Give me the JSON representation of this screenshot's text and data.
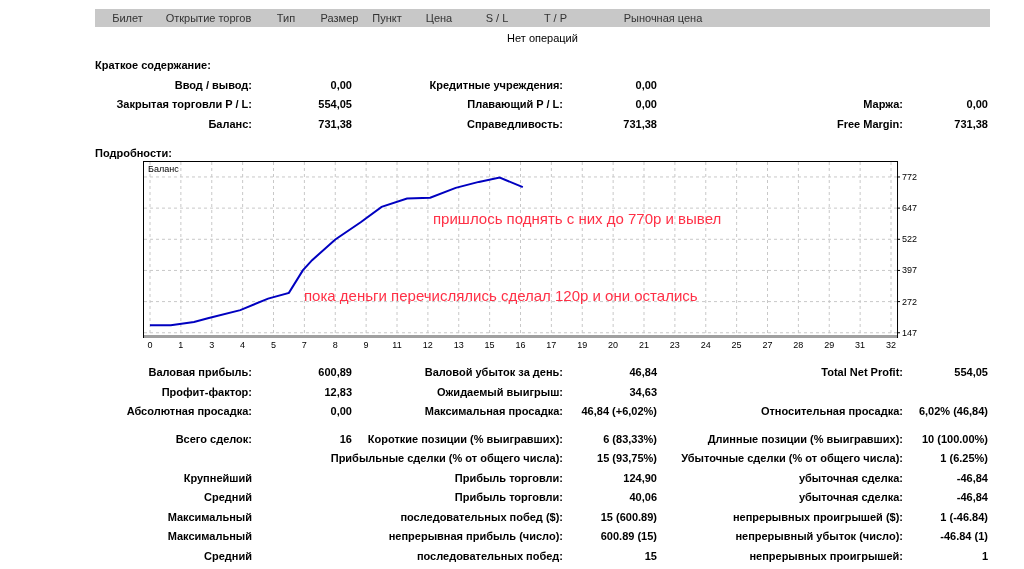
{
  "orders_table": {
    "columns": [
      "Билет",
      "Открытие торгов",
      "Тип",
      "Размер",
      "Пункт",
      "Цена",
      "S / L",
      "T / P",
      "Рыночная цена"
    ],
    "empty_message": "Нет операций"
  },
  "summary": {
    "title": "Краткое содержание:",
    "rows": [
      {
        "label_1": "Ввод / вывод:",
        "value_1": "0,00",
        "label_2": "Кредитные учреждения:",
        "value_2": "0,00"
      },
      {
        "label_1": "Закрытая торговли P / L:",
        "value_1": "554,05",
        "label_2": "Плавающий P / L:",
        "value_2": "0,00",
        "label_3": "Маржа:",
        "value_3": "0,00"
      },
      {
        "label_1": "Баланс:",
        "value_1": "731,38",
        "label_2": "Справедливость:",
        "value_2": "731,38",
        "label_3": "Free Margin:",
        "value_3": "731,38"
      }
    ]
  },
  "details": {
    "title": "Подробности:",
    "chart_data": {
      "type": "line",
      "title": "Баланс",
      "grid": true,
      "xlim": [
        0,
        32.26
      ],
      "ylim": [
        130,
        824
      ],
      "xticks": [
        {
          "value": 0,
          "label": "0"
        },
        {
          "value": 1.333,
          "label": "1"
        },
        {
          "value": 2.667,
          "label": "3"
        },
        {
          "value": 4,
          "label": "4"
        },
        {
          "value": 5.333,
          "label": "5"
        },
        {
          "value": 6.667,
          "label": "7"
        },
        {
          "value": 8,
          "label": "8"
        },
        {
          "value": 9.333,
          "label": "9"
        },
        {
          "value": 10.667,
          "label": "11"
        },
        {
          "value": 12,
          "label": "12"
        },
        {
          "value": 13.333,
          "label": "13"
        },
        {
          "value": 14.667,
          "label": "15"
        },
        {
          "value": 16,
          "label": "16"
        },
        {
          "value": 17.333,
          "label": "17"
        },
        {
          "value": 18.667,
          "label": "19"
        },
        {
          "value": 20,
          "label": "20"
        },
        {
          "value": 21.333,
          "label": "21"
        },
        {
          "value": 22.667,
          "label": "23"
        },
        {
          "value": 24,
          "label": "24"
        },
        {
          "value": 25.333,
          "label": "25"
        },
        {
          "value": 26.667,
          "label": "27"
        },
        {
          "value": 28,
          "label": "28"
        },
        {
          "value": 29.333,
          "label": "29"
        },
        {
          "value": 30.667,
          "label": "31"
        },
        {
          "value": 32,
          "label": "32"
        }
      ],
      "yticks": [
        147,
        272,
        397,
        522,
        647,
        772
      ],
      "x": [
        0,
        0.9,
        1.9,
        2.5,
        3.9,
        5.1,
        6,
        6.6,
        7,
        8,
        9.1,
        10,
        11.1,
        12.1,
        13.2,
        14.2,
        15.1,
        16.1
      ],
      "series": [
        {
          "color": "#0000c0",
          "values": [
            177,
            177,
            190,
            205,
            238,
            284,
            307,
            397,
            438,
            521,
            590,
            652,
            685,
            689,
            728,
            752,
            770,
            731
          ]
        }
      ],
      "annotations": [
        "пришлось поднять с них до 770р и вывел",
        "пока деньги перечислялись сделал 120р и они остались"
      ]
    },
    "stat_groups": [
      [
        {
          "label_1": "Валовая прибыль:",
          "value_1": "600,89",
          "label_2": "Валовой убыток за день:",
          "value_2": "46,84",
          "label_3": "Total Net Profit:",
          "value_3": "554,05"
        },
        {
          "label_1": "Профит-фактор:",
          "value_1": "12,83",
          "label_2": "Ожидаемый выигрыш:",
          "value_2": "34,63"
        },
        {
          "label_1": "Абсолютная просадка:",
          "value_1": "0,00",
          "label_2": "Максимальная просадка:",
          "value_2": "46,84 (+6,02%)",
          "label_3": "Относительная просадка:",
          "value_3": "6,02% (46,84)"
        }
      ],
      [
        {
          "label_1": "Всего сделок:",
          "value_1": "16",
          "label_2": "Короткие позиции (% выигравших):",
          "value_2": "6 (83,33%)",
          "label_3": "Длинные позиции (% выигравших):",
          "value_3": "10 (100.00%)"
        },
        {
          "label_2": "Прибыльные сделки (% от общего числа):",
          "value_2": "15 (93,75%)",
          "label_3": "Убыточные сделки (% от общего числа):",
          "value_3": "1 (6.25%)"
        },
        {
          "label_1": "Крупнейший",
          "label_2": "Прибыль торговли:",
          "value_2": "124,90",
          "label_3": "убыточная сделка:",
          "value_3": "-46,84"
        },
        {
          "label_1": "Средний",
          "label_2": "Прибыль торговли:",
          "value_2": "40,06",
          "label_3": "убыточная сделка:",
          "value_3": "-46,84"
        },
        {
          "label_1": "Максимальный",
          "label_2": "последовательных побед ($):",
          "value_2": "15 (600.89)",
          "label_3": "непрерывных проигрышей ($):",
          "value_3": "1 (-46.84)"
        },
        {
          "label_1": "Максимальный",
          "label_2": "непрерывная прибыль (число):",
          "value_2": "600.89 (15)",
          "label_3": "непрерывный убыток (число):",
          "value_3": "-46.84 (1)"
        },
        {
          "label_1": "Средний",
          "label_2": "последовательных побед:",
          "value_2": "15",
          "label_3": "непрерывных проигрышей:",
          "value_3": "1"
        }
      ]
    ]
  }
}
